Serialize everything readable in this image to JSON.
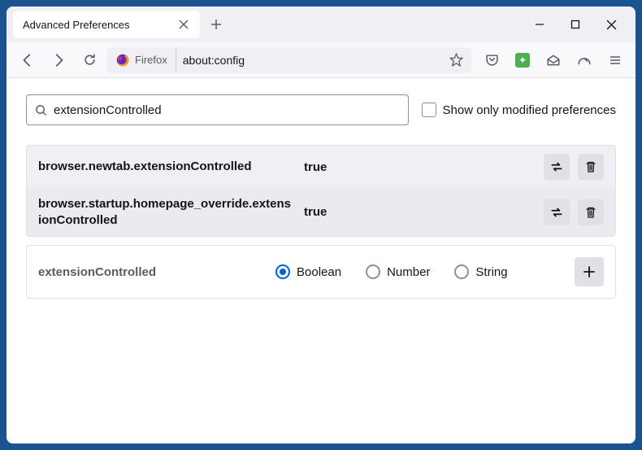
{
  "window": {
    "tab_title": "Advanced Preferences",
    "identity_label": "Firefox",
    "url": "about:config"
  },
  "search": {
    "value": "extensionControlled",
    "modified_only_label": "Show only modified preferences"
  },
  "prefs": [
    {
      "name": "browser.newtab.extensionControlled",
      "value": "true"
    },
    {
      "name": "browser.startup.homepage_override.extensionControlled",
      "value": "true"
    }
  ],
  "new_pref": {
    "name": "extensionControlled",
    "types": [
      "Boolean",
      "Number",
      "String"
    ],
    "selected": "Boolean"
  }
}
